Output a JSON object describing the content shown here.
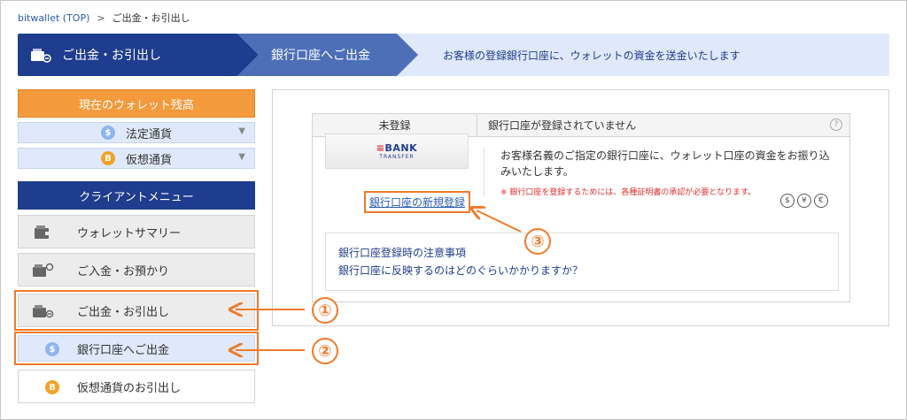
{
  "breadcrumb": {
    "home": "bitwallet (TOP)",
    "separator": ">",
    "current": "ご出金・お引出し"
  },
  "steps": {
    "step1": "ご出金・お引出し",
    "step2": "銀行口座へご出金",
    "step3": "お客様の登録銀行口座に、ウォレットの資金を送金いたします"
  },
  "sidebar": {
    "balance_title": "現在のウォレット残高",
    "fiat_label": "法定通貨",
    "fiat_icon": "$",
    "crypto_label": "仮想通貨",
    "crypto_icon": "B",
    "client_menu_title": "クライアントメニュー",
    "items": [
      {
        "label": "ウォレットサマリー"
      },
      {
        "label": "ご入金・お預かり"
      },
      {
        "label": "ご出金・お引出し"
      },
      {
        "label": "銀行口座へご出金"
      },
      {
        "label": "仮想通貨のお引出し"
      }
    ]
  },
  "card": {
    "status": "未登録",
    "status_message": "銀行口座が登録されていません",
    "help_icon": "?",
    "logo_bank": "BANK",
    "logo_transfer": "TRANSFER",
    "register_link": "銀行口座の新規登録",
    "description": "お客様名義のご指定の銀行口座に、ウォレット口座の資金をお振り込みいたします。",
    "note": "※ 銀行口座を登録するためには、各種証明書の承認が必要となります。",
    "currency_icons": [
      "$",
      "¥",
      "€"
    ]
  },
  "faq": {
    "link1": "銀行口座登録時の注意事項",
    "link2": "銀行口座に反映するのはどのぐらいかかりますか？"
  },
  "annotations": {
    "n1": "①",
    "n2": "②",
    "n3": "③"
  },
  "colors": {
    "navy": "#1f3d8e",
    "orange": "#f39a3c",
    "callout": "#f07a2a",
    "light_blue": "#dfe9fb"
  }
}
